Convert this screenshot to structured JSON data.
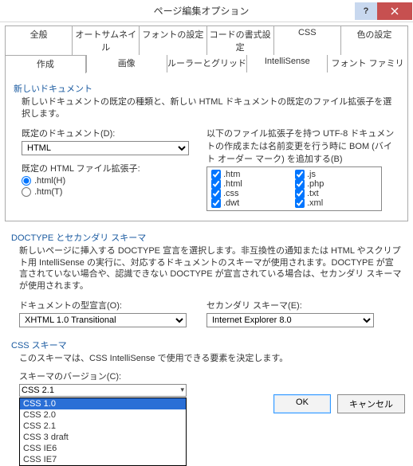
{
  "window": {
    "title": "ページ編集オプション"
  },
  "tabs_row1": [
    "全般",
    "オートサムネイル",
    "フォントの設定",
    "コードの書式設定",
    "CSS",
    "色の設定"
  ],
  "tabs_row2": [
    "作成",
    "画像",
    "ルーラーとグリッド",
    "IntelliSense",
    "フォント ファミリ"
  ],
  "active_tab": "作成",
  "sec1": {
    "title": "新しいドキュメント",
    "desc": "新しいドキュメントの既定の種類と、新しい HTML ドキュメントの既定のファイル拡張子を選択します。",
    "default_doc_label": "既定のドキュメント(D):",
    "default_doc_value": "HTML",
    "default_ext_label": "既定の HTML ファイル拡張子:",
    "radio_html": ".html(H)",
    "radio_htm": ".htm(T)",
    "utf8_desc": "以下のファイル拡張子を持つ UTF-8 ドキュメントの作成または名前変更を行う時に BOM (バイト オーダー マーク) を追加する(B)",
    "exts": [
      {
        "l": ".htm",
        "r": ".js"
      },
      {
        "l": ".html",
        "r": ".php"
      },
      {
        "l": ".css",
        "r": ".txt"
      },
      {
        "l": ".dwt",
        "r": ".xml"
      }
    ]
  },
  "sec2": {
    "title": "DOCTYPE とセカンダリ スキーマ",
    "desc": "新しいページに挿入する DOCTYPE 宣言を選択します。非互換性の通知または HTML やスクリプト用 IntelliSense の実行に、対応するドキュメントのスキーマが使用されます。DOCTYPE が宣言されていない場合や、認識できない DOCTYPE が宣言されている場合は、セカンダリ スキーマが使用されます。",
    "doctype_label": "ドキュメントの型宣言(O):",
    "doctype_value": "XHTML 1.0 Transitional",
    "secondary_label": "セカンダリ スキーマ(E):",
    "secondary_value": "Internet Explorer 8.0"
  },
  "sec3": {
    "title": "CSS スキーマ",
    "desc": "このスキーマは、CSS IntelliSense で使用できる要素を決定します。",
    "version_label": "スキーマのバージョン(C):",
    "version_value": "CSS 2.1",
    "options": [
      "CSS 1.0",
      "CSS 2.0",
      "CSS 2.1",
      "CSS 3 draft",
      "CSS IE6",
      "CSS IE7"
    ],
    "selected_option": "CSS 1.0"
  },
  "buttons": {
    "ok": "OK",
    "cancel": "キャンセル"
  }
}
